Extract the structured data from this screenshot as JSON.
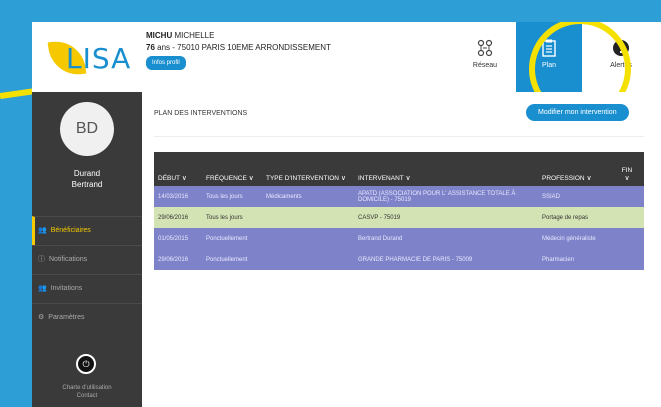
{
  "header": {
    "logo_text": "LISA",
    "patient": {
      "last_name": "MICHU",
      "first_name": "MICHELLE",
      "age": "76",
      "age_suffix": "ans",
      "address": "- 75010 PARIS 10EME ARRONDISSEMENT",
      "profile_button": "Infos profil"
    },
    "nav": [
      {
        "label": "Réseau",
        "icon": "network-icon"
      },
      {
        "label": "Plan",
        "icon": "clipboard-icon"
      },
      {
        "label": "Alertes",
        "icon": "alert-icon"
      }
    ]
  },
  "sidebar": {
    "avatar_initials": "BD",
    "user_first": "Durand",
    "user_last": "Bertrand",
    "items": [
      {
        "label": "Bénéficiaires",
        "icon": "users-icon"
      },
      {
        "label": "Notifications",
        "icon": "info-icon"
      },
      {
        "label": "Invitations",
        "icon": "group-icon"
      },
      {
        "label": "Paramètres",
        "icon": "gear-icon"
      }
    ],
    "charte": "Charte d'utilisation",
    "contact": "Contact"
  },
  "main": {
    "title": "PLAN DES INTERVENTIONS",
    "modify_button": "Modifier mon intervention",
    "columns": [
      "DÉBUT",
      "FRÉQUENCE",
      "TYPE D'INTERVENTION",
      "INTERVENANT",
      "PROFESSION",
      "FIN"
    ],
    "rows": [
      {
        "debut": "14/03/2016",
        "frequence": "Tous les jours",
        "type": "Médicaments",
        "intervenant": "APATD (ASSOCIATION POUR L' ASSISTANCE TOTALE À DOMICILE) - 75019",
        "profession": "SSIAD",
        "fin": ""
      },
      {
        "debut": "29/06/2016",
        "frequence": "Tous les jours",
        "type": "",
        "intervenant": "CASVP - 75019",
        "profession": "Portage de repas",
        "fin": ""
      },
      {
        "debut": "01/05/2015",
        "frequence": "Ponctuellement",
        "type": "",
        "intervenant": "Bertrand Durand",
        "profession": "Médecin généraliste",
        "fin": ""
      },
      {
        "debut": "29/06/2016",
        "frequence": "Ponctuellement",
        "type": "",
        "intervenant": "GRANDE PHARMACIE DE PARIS - 75009",
        "profession": "Pharmacien",
        "fin": ""
      }
    ]
  },
  "colors": {
    "background": "#2d9fd6",
    "accent": "#1a8fd0",
    "highlight": "#f5e100",
    "row_blue": "#7e83c9",
    "row_green": "#d4e3b4",
    "sidebar": "#3a3a3a"
  }
}
